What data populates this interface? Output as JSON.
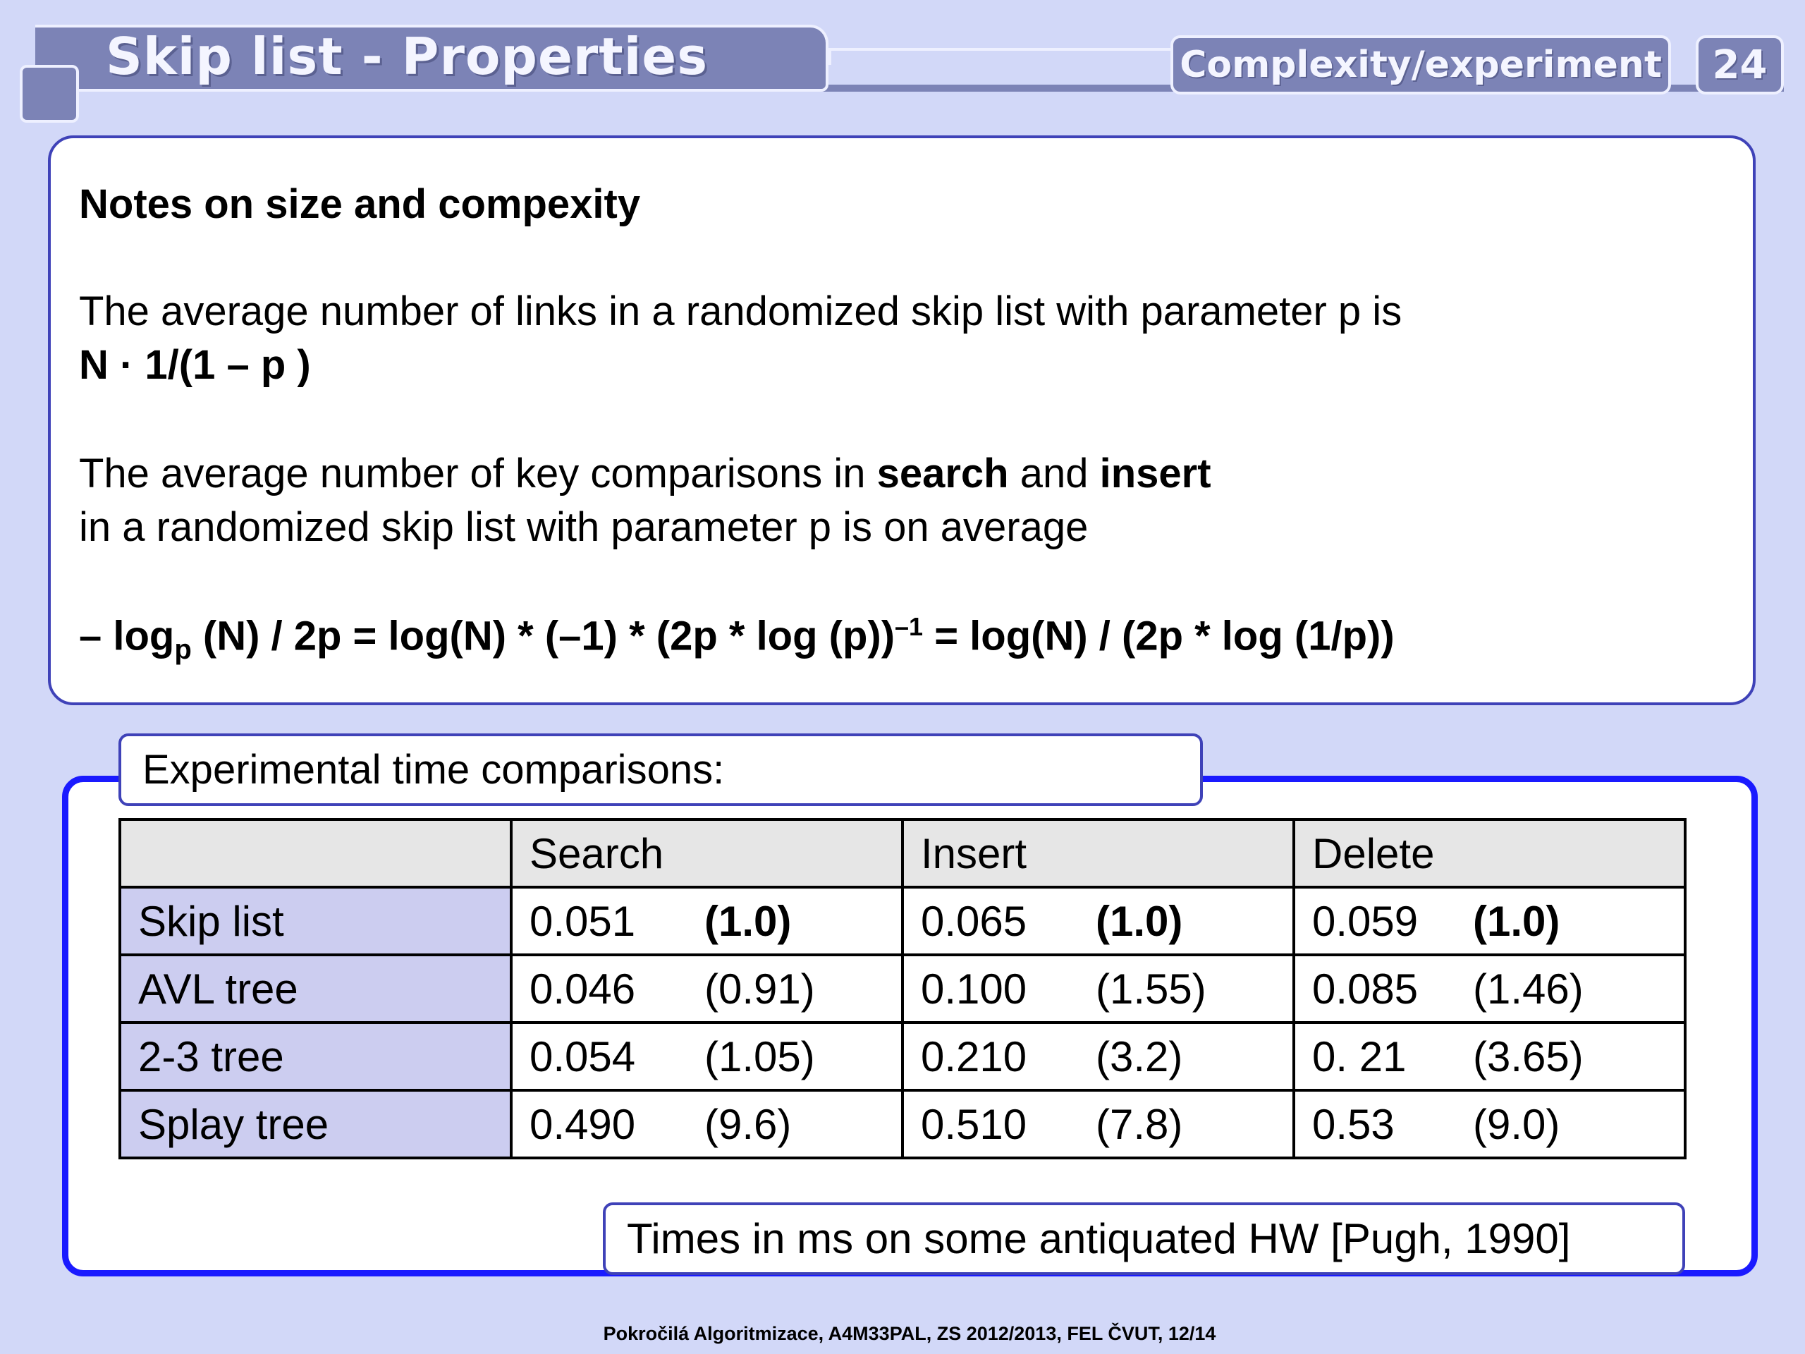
{
  "header": {
    "title": "Skip list - Properties",
    "section": "Complexity/experiment",
    "page_number": "24"
  },
  "notes": {
    "heading": "Notes on size and compexity",
    "p1_line1": "The average number of links in a randomized skip list with parameter p is",
    "p1_line2": "N ·  1/(1 – p )",
    "p2_line1_a": "The average number of key comparisons in  ",
    "p2_line1_search": "search",
    "p2_line1_and": " and ",
    "p2_line1_insert": "insert",
    "p2_line2": "in a randomized skip list with parameter p is on average",
    "formula": {
      "part1": "– log",
      "sub_p": "p",
      "part2": " (N) / 2p =  log(N) * (–1) * (2p * log (p))",
      "sup": "–1",
      "part3": " =  log(N) / (2p * log (1/p))"
    }
  },
  "experiment": {
    "label": "Experimental time comparisons:",
    "columns": [
      "",
      "Search",
      "Insert",
      "Delete"
    ],
    "rows": [
      {
        "name": "Skip list",
        "cells": [
          [
            "0.051",
            "(1.0)"
          ],
          [
            "0.065",
            "(1.0)"
          ],
          [
            "0.059",
            "(1.0)"
          ]
        ]
      },
      {
        "name": "AVL tree",
        "cells": [
          [
            "0.046",
            "(0.91)"
          ],
          [
            "0.100",
            "(1.55)"
          ],
          [
            "0.085",
            "(1.46)"
          ]
        ]
      },
      {
        "name": "2-3 tree",
        "cells": [
          [
            "0.054",
            "(1.05)"
          ],
          [
            "0.210",
            "(3.2)"
          ],
          [
            "0. 21",
            "(3.65)"
          ]
        ]
      },
      {
        "name": "Splay tree",
        "cells": [
          [
            "0.490",
            "(9.6)"
          ],
          [
            "0.510",
            "(7.8)"
          ],
          [
            "0.53",
            "(9.0)"
          ]
        ]
      }
    ],
    "footnote": "Times in ms on some antiquated HW [Pugh, 1990]"
  },
  "footer": "Pokročilá Algoritmizace, A4M33PAL, ZS 2012/2013, FEL ČVUT,  12/14"
}
